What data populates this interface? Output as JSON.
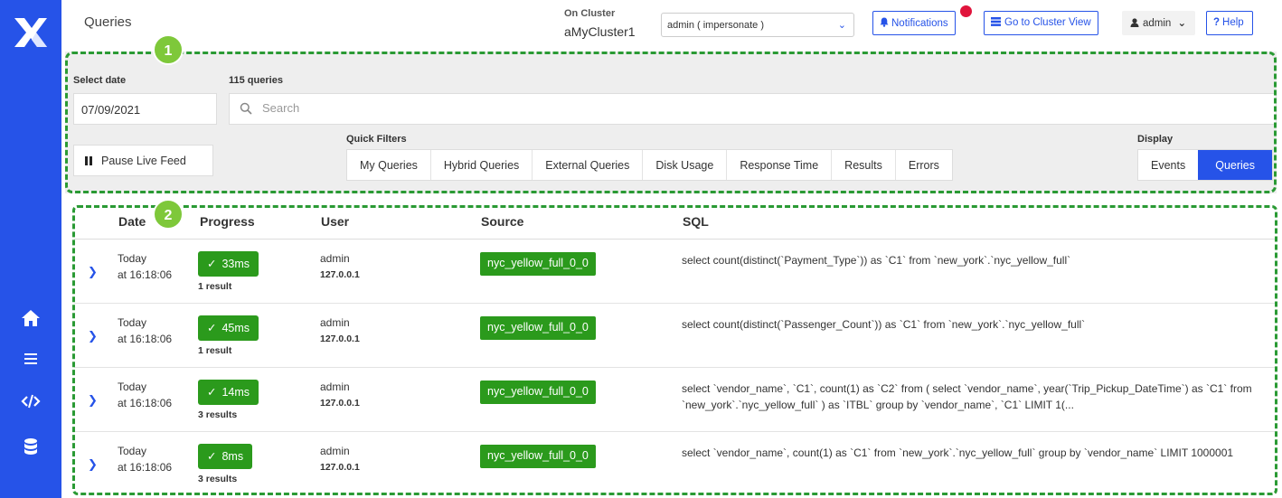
{
  "header": {
    "title": "Queries",
    "cluster_label": "On Cluster",
    "cluster_name": "aMyCluster1",
    "impersonate_value": "admin ( impersonate )",
    "notifications_label": "Notifications",
    "cluster_view_label": "Go to Cluster View",
    "user_label": "admin",
    "help_label": "Help"
  },
  "filters": {
    "select_date_label": "Select date",
    "date_value": "07/09/2021",
    "query_count": "115 queries",
    "search_placeholder": "Search",
    "pause_label": "Pause Live Feed",
    "quick_filters_label": "Quick Filters",
    "quick_filters": [
      "My Queries",
      "Hybrid Queries",
      "External Queries",
      "Disk Usage",
      "Response Time",
      "Results",
      "Errors"
    ],
    "display_label": "Display",
    "display_options": [
      "Events",
      "Queries"
    ],
    "display_selected": "Queries"
  },
  "badges": [
    "1",
    "2"
  ],
  "table": {
    "columns": [
      "Date",
      "Progress",
      "User",
      "Source",
      "SQL"
    ],
    "rows": [
      {
        "day": "Today",
        "time": "at 16:18:06",
        "duration": "33ms",
        "results": "1 result",
        "user": "admin",
        "ip": "127.0.0.1",
        "source": "nyc_yellow_full_0_0",
        "sql": "select count(distinct(`Payment_Type`)) as `C1` from `new_york`.`nyc_yellow_full`"
      },
      {
        "day": "Today",
        "time": "at 16:18:06",
        "duration": "45ms",
        "results": "1 result",
        "user": "admin",
        "ip": "127.0.0.1",
        "source": "nyc_yellow_full_0_0",
        "sql": "select count(distinct(`Passenger_Count`)) as `C1` from `new_york`.`nyc_yellow_full`"
      },
      {
        "day": "Today",
        "time": "at 16:18:06",
        "duration": "14ms",
        "results": "3 results",
        "user": "admin",
        "ip": "127.0.0.1",
        "source": "nyc_yellow_full_0_0",
        "sql": "select `vendor_name`, `C1`, count(1) as `C2` from ( select `vendor_name`, year(`Trip_Pickup_DateTime`) as `C1` from `new_york`.`nyc_yellow_full` ) as `ITBL` group by `vendor_name`, `C1` LIMIT 1(..."
      },
      {
        "day": "Today",
        "time": "at 16:18:06",
        "duration": "8ms",
        "results": "3 results",
        "user": "admin",
        "ip": "127.0.0.1",
        "source": "nyc_yellow_full_0_0",
        "sql": "select `vendor_name`, count(1) as `C1` from `new_york`.`nyc_yellow_full` group by `vendor_name` LIMIT 1000001"
      }
    ]
  },
  "icons": {
    "logo": "x-logo-icon",
    "nav": [
      "home-icon",
      "list-icon",
      "code-icon",
      "database-icon"
    ]
  },
  "colors": {
    "rail": "#2653e8",
    "accent": "#2653e8",
    "success": "#2b9a1c",
    "annotation": "#2a9a34",
    "badge": "#7ec83a",
    "notification_dot": "#e0143c"
  }
}
